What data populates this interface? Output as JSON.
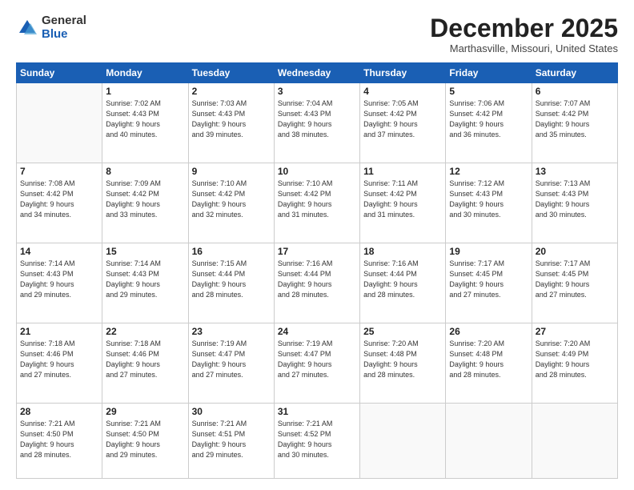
{
  "logo": {
    "general": "General",
    "blue": "Blue"
  },
  "header": {
    "month": "December 2025",
    "location": "Marthasville, Missouri, United States"
  },
  "days_of_week": [
    "Sunday",
    "Monday",
    "Tuesday",
    "Wednesday",
    "Thursday",
    "Friday",
    "Saturday"
  ],
  "weeks": [
    [
      {
        "num": "",
        "info": ""
      },
      {
        "num": "1",
        "info": "Sunrise: 7:02 AM\nSunset: 4:43 PM\nDaylight: 9 hours\nand 40 minutes."
      },
      {
        "num": "2",
        "info": "Sunrise: 7:03 AM\nSunset: 4:43 PM\nDaylight: 9 hours\nand 39 minutes."
      },
      {
        "num": "3",
        "info": "Sunrise: 7:04 AM\nSunset: 4:43 PM\nDaylight: 9 hours\nand 38 minutes."
      },
      {
        "num": "4",
        "info": "Sunrise: 7:05 AM\nSunset: 4:42 PM\nDaylight: 9 hours\nand 37 minutes."
      },
      {
        "num": "5",
        "info": "Sunrise: 7:06 AM\nSunset: 4:42 PM\nDaylight: 9 hours\nand 36 minutes."
      },
      {
        "num": "6",
        "info": "Sunrise: 7:07 AM\nSunset: 4:42 PM\nDaylight: 9 hours\nand 35 minutes."
      }
    ],
    [
      {
        "num": "7",
        "info": "Sunrise: 7:08 AM\nSunset: 4:42 PM\nDaylight: 9 hours\nand 34 minutes."
      },
      {
        "num": "8",
        "info": "Sunrise: 7:09 AM\nSunset: 4:42 PM\nDaylight: 9 hours\nand 33 minutes."
      },
      {
        "num": "9",
        "info": "Sunrise: 7:10 AM\nSunset: 4:42 PM\nDaylight: 9 hours\nand 32 minutes."
      },
      {
        "num": "10",
        "info": "Sunrise: 7:10 AM\nSunset: 4:42 PM\nDaylight: 9 hours\nand 31 minutes."
      },
      {
        "num": "11",
        "info": "Sunrise: 7:11 AM\nSunset: 4:42 PM\nDaylight: 9 hours\nand 31 minutes."
      },
      {
        "num": "12",
        "info": "Sunrise: 7:12 AM\nSunset: 4:43 PM\nDaylight: 9 hours\nand 30 minutes."
      },
      {
        "num": "13",
        "info": "Sunrise: 7:13 AM\nSunset: 4:43 PM\nDaylight: 9 hours\nand 30 minutes."
      }
    ],
    [
      {
        "num": "14",
        "info": "Sunrise: 7:14 AM\nSunset: 4:43 PM\nDaylight: 9 hours\nand 29 minutes."
      },
      {
        "num": "15",
        "info": "Sunrise: 7:14 AM\nSunset: 4:43 PM\nDaylight: 9 hours\nand 29 minutes."
      },
      {
        "num": "16",
        "info": "Sunrise: 7:15 AM\nSunset: 4:44 PM\nDaylight: 9 hours\nand 28 minutes."
      },
      {
        "num": "17",
        "info": "Sunrise: 7:16 AM\nSunset: 4:44 PM\nDaylight: 9 hours\nand 28 minutes."
      },
      {
        "num": "18",
        "info": "Sunrise: 7:16 AM\nSunset: 4:44 PM\nDaylight: 9 hours\nand 28 minutes."
      },
      {
        "num": "19",
        "info": "Sunrise: 7:17 AM\nSunset: 4:45 PM\nDaylight: 9 hours\nand 27 minutes."
      },
      {
        "num": "20",
        "info": "Sunrise: 7:17 AM\nSunset: 4:45 PM\nDaylight: 9 hours\nand 27 minutes."
      }
    ],
    [
      {
        "num": "21",
        "info": "Sunrise: 7:18 AM\nSunset: 4:46 PM\nDaylight: 9 hours\nand 27 minutes."
      },
      {
        "num": "22",
        "info": "Sunrise: 7:18 AM\nSunset: 4:46 PM\nDaylight: 9 hours\nand 27 minutes."
      },
      {
        "num": "23",
        "info": "Sunrise: 7:19 AM\nSunset: 4:47 PM\nDaylight: 9 hours\nand 27 minutes."
      },
      {
        "num": "24",
        "info": "Sunrise: 7:19 AM\nSunset: 4:47 PM\nDaylight: 9 hours\nand 27 minutes."
      },
      {
        "num": "25",
        "info": "Sunrise: 7:20 AM\nSunset: 4:48 PM\nDaylight: 9 hours\nand 28 minutes."
      },
      {
        "num": "26",
        "info": "Sunrise: 7:20 AM\nSunset: 4:48 PM\nDaylight: 9 hours\nand 28 minutes."
      },
      {
        "num": "27",
        "info": "Sunrise: 7:20 AM\nSunset: 4:49 PM\nDaylight: 9 hours\nand 28 minutes."
      }
    ],
    [
      {
        "num": "28",
        "info": "Sunrise: 7:21 AM\nSunset: 4:50 PM\nDaylight: 9 hours\nand 28 minutes."
      },
      {
        "num": "29",
        "info": "Sunrise: 7:21 AM\nSunset: 4:50 PM\nDaylight: 9 hours\nand 29 minutes."
      },
      {
        "num": "30",
        "info": "Sunrise: 7:21 AM\nSunset: 4:51 PM\nDaylight: 9 hours\nand 29 minutes."
      },
      {
        "num": "31",
        "info": "Sunrise: 7:21 AM\nSunset: 4:52 PM\nDaylight: 9 hours\nand 30 minutes."
      },
      {
        "num": "",
        "info": ""
      },
      {
        "num": "",
        "info": ""
      },
      {
        "num": "",
        "info": ""
      }
    ]
  ]
}
